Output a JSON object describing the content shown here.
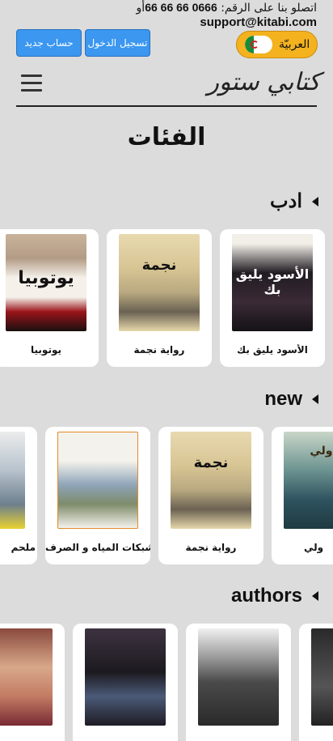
{
  "contact": {
    "phone_label": "اتصلو بنا على الرقم:",
    "phone_number": "0666 66 66 66",
    "or": "أو",
    "email": "support@kitabi.com"
  },
  "auth": {
    "signup_label": "حساب جديد",
    "login_label": "تسجيل الدخول"
  },
  "language": {
    "label": "العربيّة"
  },
  "brand": {
    "name": "كتابي ستور"
  },
  "page": {
    "title": "الفئات"
  },
  "sections": [
    {
      "name": "ادب",
      "books": [
        {
          "title": "الأسود يليق بك",
          "cover_text": "الأسود يليق بك"
        },
        {
          "title": "رواية نجمة",
          "cover_text": "نجمة"
        },
        {
          "title": "يوتوبيا",
          "cover_text": "يوتوبيا"
        }
      ]
    },
    {
      "name": "new",
      "books": [
        {
          "title": "ولي",
          "cover_text": "دولي"
        },
        {
          "title": "رواية نجمة",
          "cover_text": "نجمة"
        },
        {
          "title": "شبكات المياه و الصرف",
          "cover_text": ""
        },
        {
          "title": "ملحم",
          "cover_text": ""
        }
      ]
    },
    {
      "name": "authors",
      "books": [
        {
          "title": ""
        },
        {
          "title": ""
        },
        {
          "title": ""
        },
        {
          "title": ""
        }
      ]
    }
  ],
  "colors": {
    "background": "#dcdcdc",
    "button_blue": "#3b97f0",
    "language_yellow": "#f4b21e"
  }
}
